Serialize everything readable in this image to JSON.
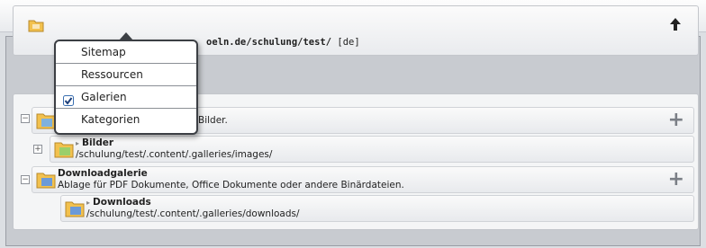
{
  "toolbar": {
    "left_icons": [
      "history-icon",
      "clipboard-icon",
      "magic-wand-icon",
      "tree-view-icon"
    ],
    "right_icons": [
      "context-menu-icon",
      "close-icon"
    ]
  },
  "menu": {
    "items": [
      {
        "label": "Sitemap",
        "checked": false
      },
      {
        "label": "Ressourcen",
        "checked": false
      },
      {
        "label": "Galerien",
        "checked": true
      },
      {
        "label": "Kategorien",
        "checked": false
      }
    ]
  },
  "path_bar": {
    "path_bold": "oeln.de/schulung/test/",
    "locale": "[de]"
  },
  "list": {
    "rows": [
      {
        "title": "",
        "subtitle": "Bilder."
      },
      {
        "title": "Bilder",
        "subtitle": "/schulung/test/.content/.galleries/images/"
      },
      {
        "title": "Downloadgalerie",
        "subtitle": "Ablage für PDF Dokumente, Office Dokumente oder andere Binärdateien."
      },
      {
        "title": "Downloads",
        "subtitle": "/schulung/test/.content/.galleries/downloads/"
      }
    ]
  },
  "colors": {
    "folder": "#f2c14e",
    "accent": "#3a6fb0"
  }
}
